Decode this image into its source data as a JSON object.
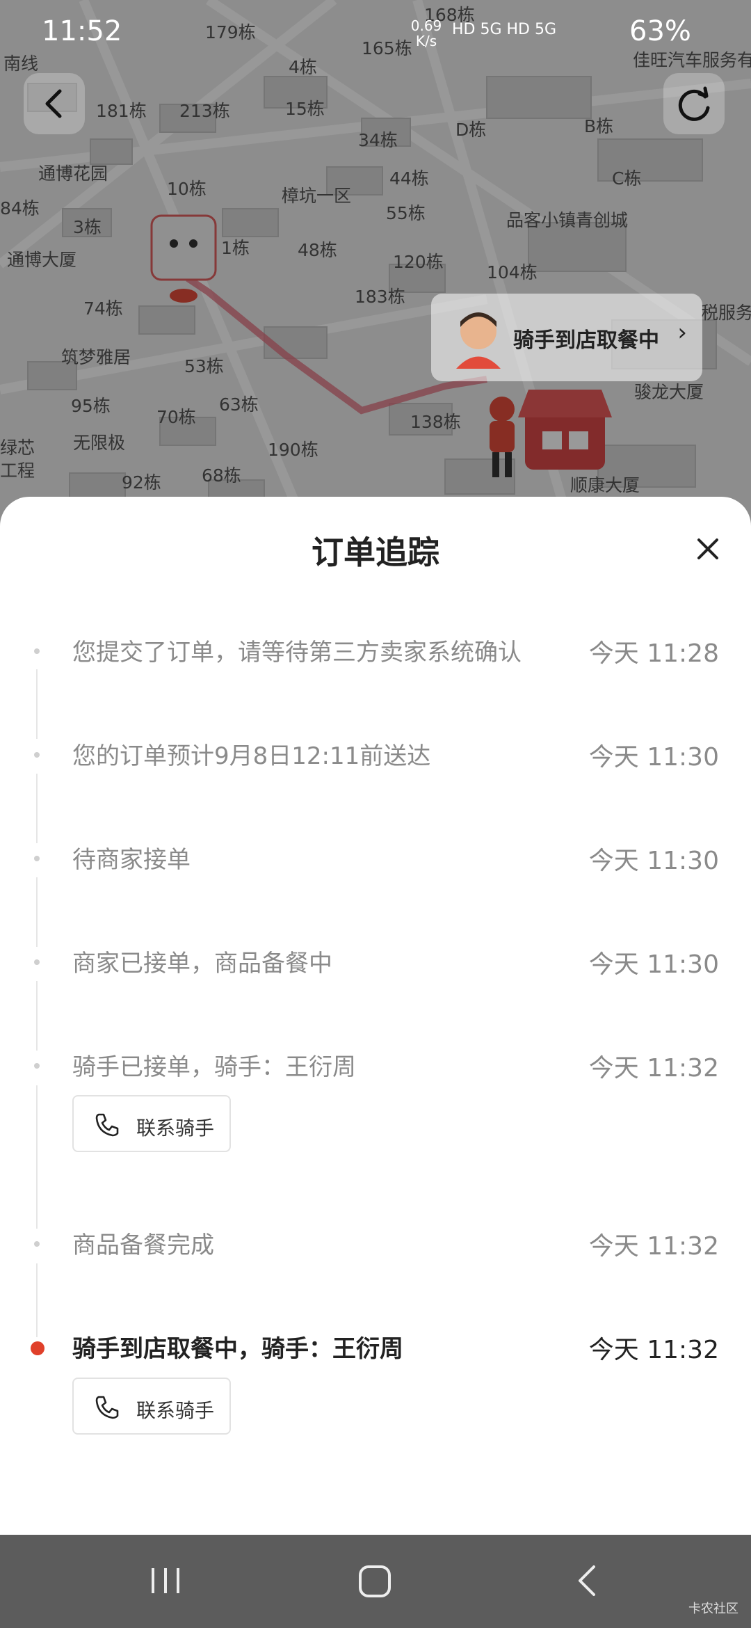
{
  "status_bar": {
    "time": "11:52",
    "net_speed": "0.69 K/s",
    "indicators": "HD 5G HD 5G",
    "battery": "63%"
  },
  "map": {
    "labels": [
      "南线",
      "179栋",
      "168栋",
      "165栋",
      "4栋",
      "佳旺汽车服务有限",
      "181栋",
      "213栋",
      "15栋",
      "34栋",
      "D栋",
      "B栋",
      "通博花园",
      "10栋",
      "樟坑一区",
      "44栋",
      "C栋",
      "84栋",
      "3栋",
      "55栋",
      "品客小镇青创城",
      "1栋",
      "48栋",
      "120栋",
      "通博大厦",
      "104栋",
      "74栋",
      "183栋",
      "税服务",
      "筑梦雅居",
      "53栋",
      "95栋",
      "63栋",
      "骏龙大厦",
      "70栋",
      "138栋",
      "绿芯",
      "无限极",
      "190栋",
      "工程",
      "92栋",
      "68栋",
      "顺康大厦"
    ],
    "rider_bubble": "骑手到店取餐中"
  },
  "icons": {
    "back": "chevron-left-icon",
    "refresh": "refresh-icon",
    "close": "close-icon",
    "phone": "phone-icon"
  },
  "sheet": {
    "title": "订单追踪",
    "events": [
      {
        "text": "您提交了订单，请等待第三方卖家系统确认",
        "time": "今天 11:28"
      },
      {
        "text": "您的订单预计9月8日12:11前送达",
        "time": "今天 11:30"
      },
      {
        "text": "待商家接单",
        "time": "今天 11:30"
      },
      {
        "text": "商家已接单，商品备餐中",
        "time": "今天 11:30"
      },
      {
        "text": "骑手已接单，骑手：王衍周",
        "time": "今天 11:32",
        "button": "联系骑手"
      },
      {
        "text": "商品备餐完成",
        "time": "今天 11:32"
      },
      {
        "text": "骑手到店取餐中，骑手：王衍周",
        "time": "今天 11:32",
        "button": "联系骑手",
        "active": true
      }
    ]
  },
  "colors": {
    "accent": "#e0402a",
    "muted_text": "#8a8a8a",
    "dark_text": "#222222"
  },
  "watermark": "卡农社区"
}
